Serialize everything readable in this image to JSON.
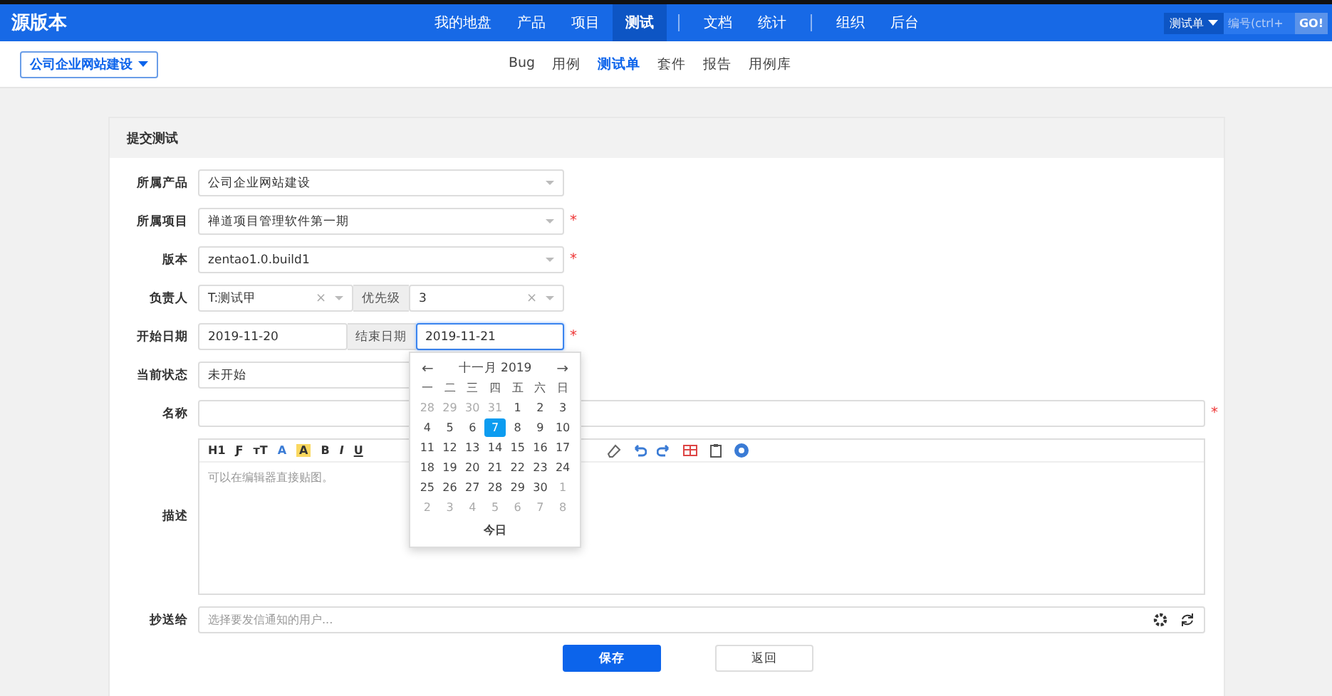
{
  "header": {
    "brand": "源版本",
    "nav": [
      {
        "label": "我的地盘",
        "selected": false
      },
      {
        "label": "产品",
        "selected": false
      },
      {
        "label": "项目",
        "selected": false
      },
      {
        "label": "测试",
        "selected": true
      },
      {
        "kind": "divider"
      },
      {
        "label": "文档",
        "selected": false
      },
      {
        "label": "统计",
        "selected": false
      },
      {
        "kind": "divider"
      },
      {
        "label": "组织",
        "selected": false
      },
      {
        "label": "后台",
        "selected": false
      }
    ],
    "search_type": "测试单",
    "search": {
      "placeholder": "编号(ctrl+"
    },
    "go": "GO!"
  },
  "subnav": {
    "breadcrumb": "公司企业网站建设",
    "items": [
      {
        "label": "Bug",
        "selected": false
      },
      {
        "label": "用例",
        "selected": false
      },
      {
        "label": "测试单",
        "selected": true
      },
      {
        "label": "套件",
        "selected": false
      },
      {
        "label": "报告",
        "selected": false
      },
      {
        "label": "用例库",
        "selected": false
      }
    ]
  },
  "form": {
    "title": "提交测试",
    "required_mark": "*",
    "clear": "×",
    "rows": [
      {
        "kind": "select",
        "label": "所属产品",
        "value": "公司企业网站建设",
        "required": false
      },
      {
        "kind": "select",
        "label": "所属项目",
        "value": "禅道项目管理软件第一期",
        "required": true
      },
      {
        "kind": "select",
        "label": "版本",
        "value": "zentao1.0.build1",
        "required": true
      },
      {
        "kind": "pair",
        "label": "负责人",
        "value": "T:测试甲",
        "addon": "优先级",
        "value2": "3",
        "required": false
      },
      {
        "kind": "dates",
        "label": "开始日期",
        "value": "2019-11-20",
        "addon": "结束日期",
        "value2": "2019-11-21",
        "required": true
      },
      {
        "kind": "select",
        "label": "当前状态",
        "value": "未开始",
        "required": false
      },
      {
        "kind": "input",
        "label": "名称",
        "required": true
      },
      {
        "kind": "editor",
        "label": "描述",
        "placeholder": "可以在编辑器直接贴图。",
        "toolbar": [
          "H1",
          "Ƒ",
          "тT",
          "A",
          "A",
          "B",
          "I",
          "U"
        ]
      },
      {
        "kind": "mail",
        "label": "抄送给",
        "placeholder": "选择要发信通知的用户..."
      }
    ],
    "buttons": [
      {
        "label": "保存",
        "kind": "primary"
      },
      {
        "label": "返回",
        "kind": "default"
      }
    ]
  },
  "calendar": {
    "month": "十一月 2019",
    "prev": "←",
    "next": "→",
    "weekdays": [
      "一",
      "二",
      "三",
      "四",
      "五",
      "六",
      "日"
    ],
    "weeks": [
      [
        {
          "day": "28",
          "other_month": true,
          "selected": false
        },
        {
          "day": "29",
          "other_month": true,
          "selected": false
        },
        {
          "day": "30",
          "other_month": true,
          "selected": false
        },
        {
          "day": "31",
          "other_month": true,
          "selected": false
        },
        {
          "day": "1",
          "other_month": false,
          "selected": false
        },
        {
          "day": "2",
          "other_month": false,
          "selected": false
        },
        {
          "day": "3",
          "other_month": false,
          "selected": false
        }
      ],
      [
        {
          "day": "4",
          "other_month": false,
          "selected": false
        },
        {
          "day": "5",
          "other_month": false,
          "selected": false
        },
        {
          "day": "6",
          "other_month": false,
          "selected": false
        },
        {
          "day": "7",
          "other_month": false,
          "selected": true
        },
        {
          "day": "8",
          "other_month": false,
          "selected": false
        },
        {
          "day": "9",
          "other_month": false,
          "selected": false
        },
        {
          "day": "10",
          "other_month": false,
          "selected": false
        }
      ],
      [
        {
          "day": "11",
          "other_month": false,
          "selected": false
        },
        {
          "day": "12",
          "other_month": false,
          "selected": false
        },
        {
          "day": "13",
          "other_month": false,
          "selected": false
        },
        {
          "day": "14",
          "other_month": false,
          "selected": false
        },
        {
          "day": "15",
          "other_month": false,
          "selected": false
        },
        {
          "day": "16",
          "other_month": false,
          "selected": false
        },
        {
          "day": "17",
          "other_month": false,
          "selected": false
        }
      ],
      [
        {
          "day": "18",
          "other_month": false,
          "selected": false
        },
        {
          "day": "19",
          "other_month": false,
          "selected": false
        },
        {
          "day": "20",
          "other_month": false,
          "selected": false
        },
        {
          "day": "21",
          "other_month": false,
          "selected": false
        },
        {
          "day": "22",
          "other_month": false,
          "selected": false
        },
        {
          "day": "23",
          "other_month": false,
          "selected": false
        },
        {
          "day": "24",
          "other_month": false,
          "selected": false
        }
      ],
      [
        {
          "day": "25",
          "other_month": false,
          "selected": false
        },
        {
          "day": "26",
          "other_month": false,
          "selected": false
        },
        {
          "day": "27",
          "other_month": false,
          "selected": false
        },
        {
          "day": "28",
          "other_month": false,
          "selected": false
        },
        {
          "day": "29",
          "other_month": false,
          "selected": false
        },
        {
          "day": "30",
          "other_month": false,
          "selected": false
        },
        {
          "day": "1",
          "other_month": true,
          "selected": false
        }
      ],
      [
        {
          "day": "2",
          "other_month": true,
          "selected": false
        },
        {
          "day": "3",
          "other_month": true,
          "selected": false
        },
        {
          "day": "4",
          "other_month": true,
          "selected": false
        },
        {
          "day": "5",
          "other_month": true,
          "selected": false
        },
        {
          "day": "6",
          "other_month": true,
          "selected": false
        },
        {
          "day": "7",
          "other_month": true,
          "selected": false
        },
        {
          "day": "8",
          "other_month": true,
          "selected": false
        }
      ]
    ],
    "today": "今日"
  }
}
